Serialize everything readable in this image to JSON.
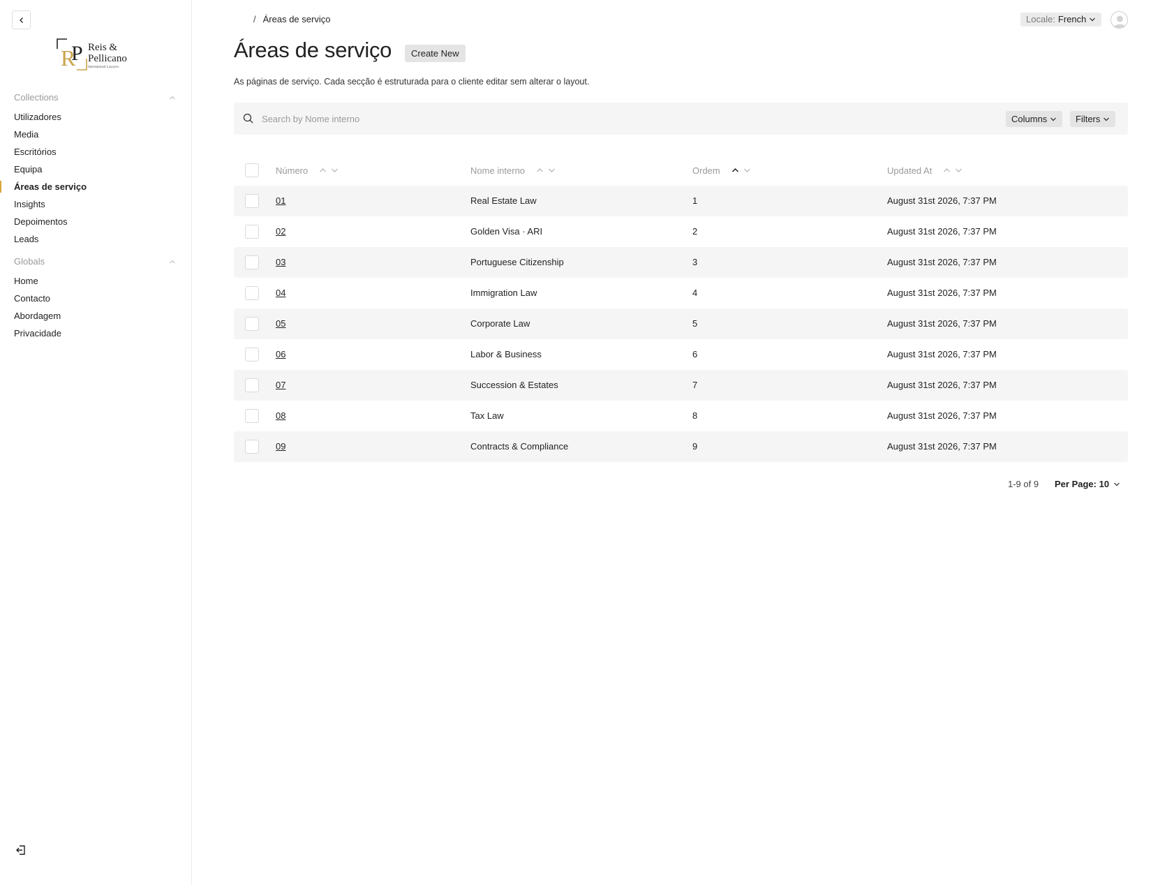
{
  "sidebar": {
    "brand": {
      "line1": "Reis &",
      "line2": "Pellicano",
      "tagline": "International Lawyers",
      "initials": "RP",
      "accent": "#c9a24a"
    },
    "groups": [
      {
        "title": "Collections",
        "items": [
          "Utilizadores",
          "Media",
          "Escritórios",
          "Equipa",
          "Áreas de serviço",
          "Insights",
          "Depoimentos",
          "Leads"
        ],
        "active": "Áreas de serviço"
      },
      {
        "title": "Globals",
        "items": [
          "Home",
          "Contacto",
          "Abordagem",
          "Privacidade"
        ]
      }
    ],
    "icons": {
      "collapse": "chevron-left-icon",
      "logout": "logout-icon"
    }
  },
  "header": {
    "breadcrumb": {
      "separator": "/",
      "current": "Áreas de serviço"
    },
    "locale": {
      "label": "Locale:",
      "value": "French"
    }
  },
  "page": {
    "title": "Áreas de serviço",
    "create_label": "Create New",
    "description": "As páginas de serviço. Cada secção é estruturada para o cliente editar sem alterar o layout."
  },
  "search": {
    "placeholder": "Search by Nome interno",
    "value": "",
    "columns_label": "Columns",
    "filters_label": "Filters"
  },
  "table": {
    "columns": [
      "Número",
      "Nome interno",
      "Ordem",
      "Updated At"
    ],
    "sorted_column": "Ordem",
    "sort_direction": "ascending",
    "rows": [
      {
        "numero": "01",
        "nome": "Real Estate Law",
        "ordem": "1",
        "updated": "August 31st 2026, 7:37 PM"
      },
      {
        "numero": "02",
        "nome": "Golden Visa · ARI",
        "ordem": "2",
        "updated": "August 31st 2026, 7:37 PM"
      },
      {
        "numero": "03",
        "nome": "Portuguese Citizenship",
        "ordem": "3",
        "updated": "August 31st 2026, 7:37 PM"
      },
      {
        "numero": "04",
        "nome": "Immigration Law",
        "ordem": "4",
        "updated": "August 31st 2026, 7:37 PM"
      },
      {
        "numero": "05",
        "nome": "Corporate Law",
        "ordem": "5",
        "updated": "August 31st 2026, 7:37 PM"
      },
      {
        "numero": "06",
        "nome": "Labor & Business",
        "ordem": "6",
        "updated": "August 31st 2026, 7:37 PM"
      },
      {
        "numero": "07",
        "nome": "Succession & Estates",
        "ordem": "7",
        "updated": "August 31st 2026, 7:37 PM"
      },
      {
        "numero": "08",
        "nome": "Tax Law",
        "ordem": "8",
        "updated": "August 31st 2026, 7:37 PM"
      },
      {
        "numero": "09",
        "nome": "Contracts & Compliance",
        "ordem": "9",
        "updated": "August 31st 2026, 7:37 PM"
      }
    ]
  },
  "pagination": {
    "range": "1-9 of 9",
    "per_page_label": "Per Page: 10"
  }
}
